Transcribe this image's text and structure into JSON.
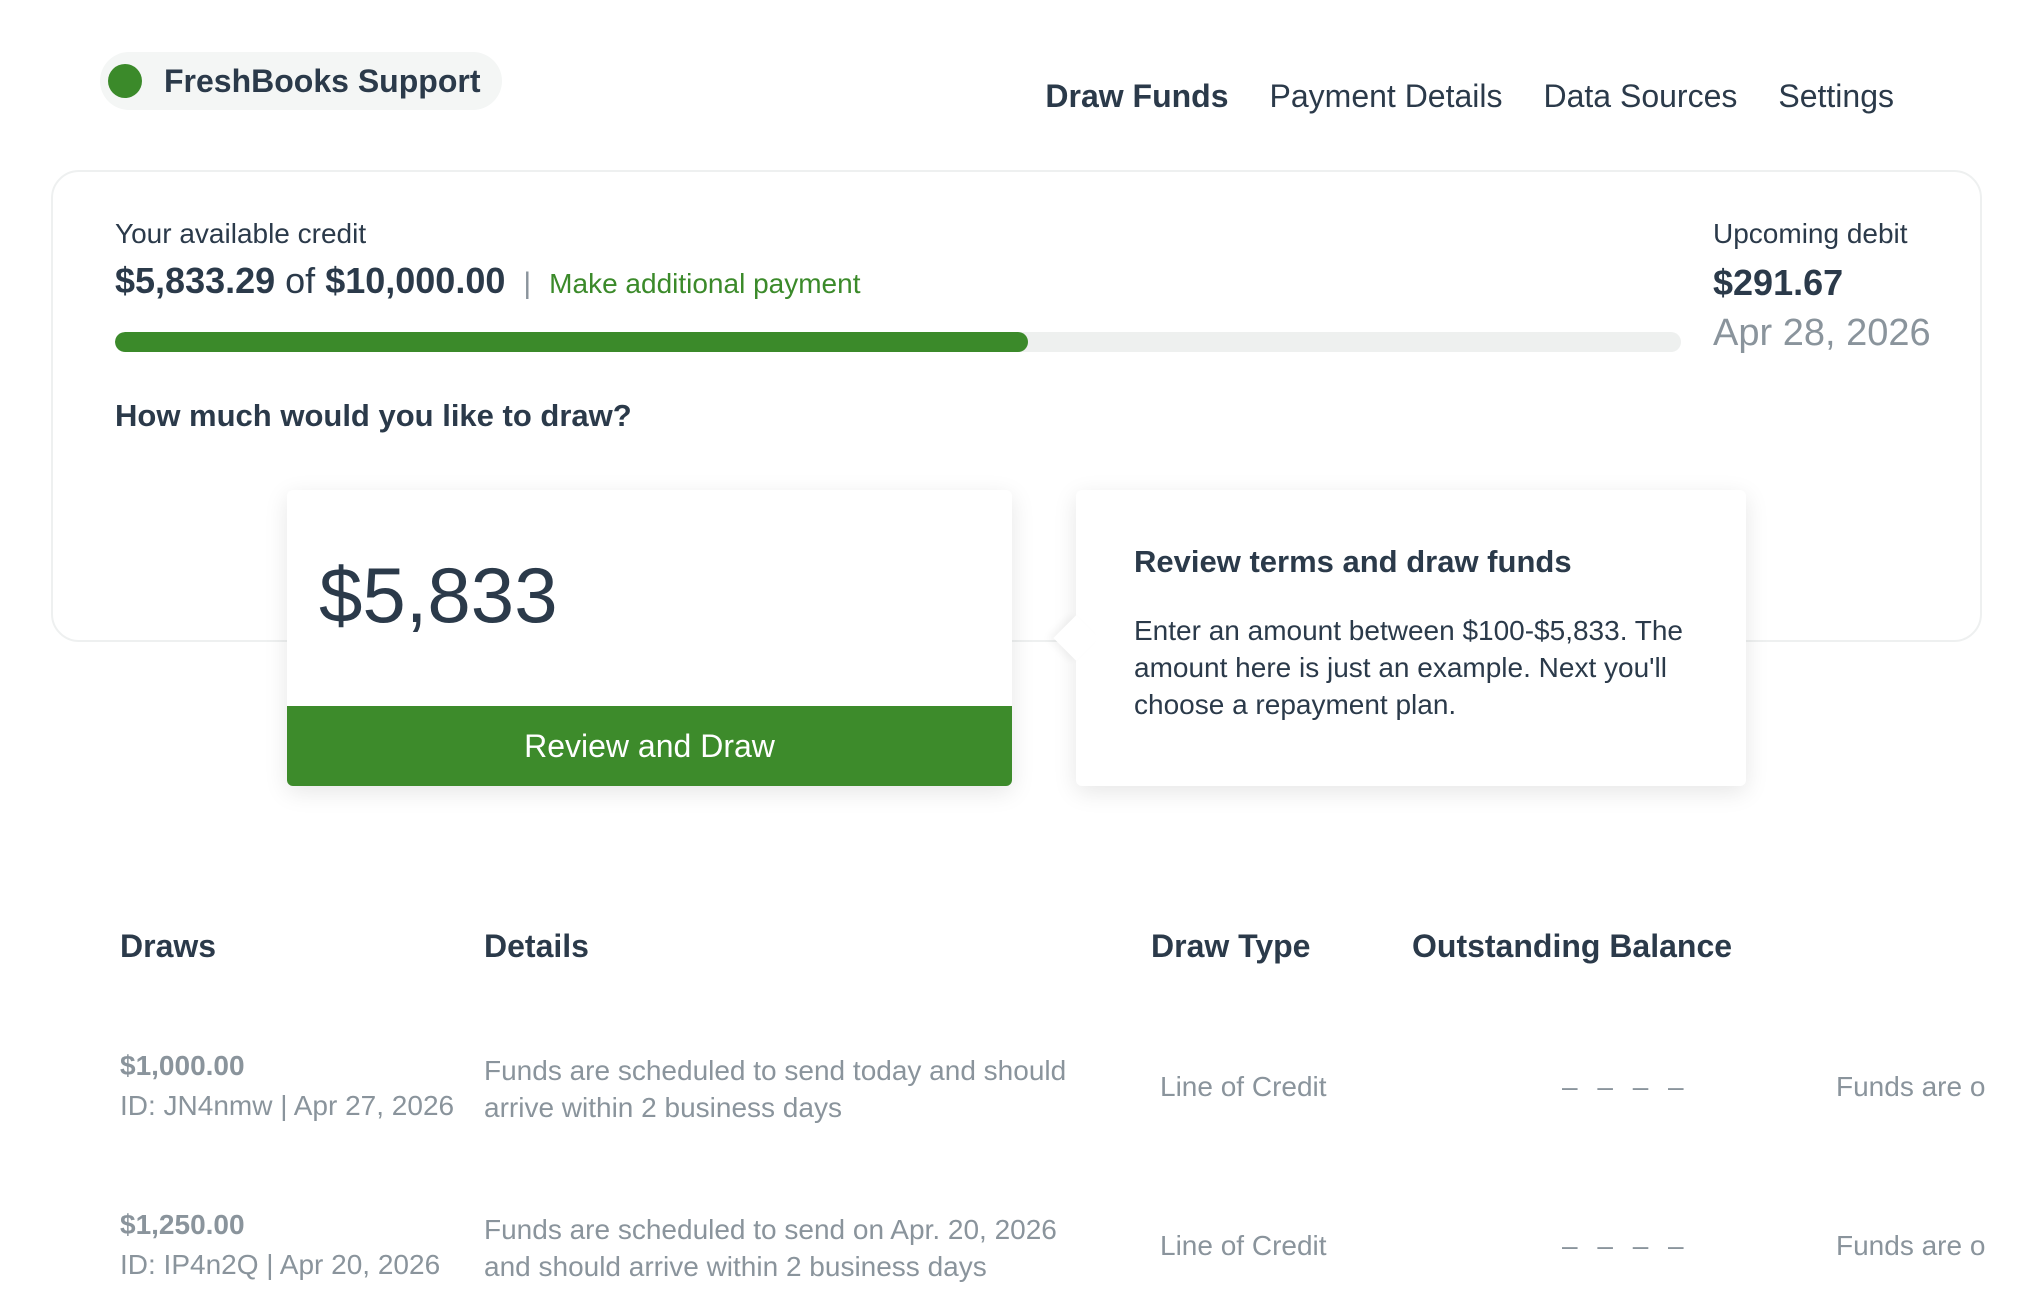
{
  "brand": {
    "name": "FreshBooks Support"
  },
  "nav": {
    "items": [
      {
        "label": "Draw Funds"
      },
      {
        "label": "Payment Details"
      },
      {
        "label": "Data Sources"
      },
      {
        "label": "Settings"
      }
    ]
  },
  "credit": {
    "label": "Your available credit",
    "available": "$5,833.29",
    "of": "of",
    "limit": "$10,000.00",
    "separator": "|",
    "payment_link": "Make additional payment",
    "progress_percent": 58.3
  },
  "debit": {
    "label": "Upcoming debit",
    "amount": "$291.67",
    "date": "Apr 28, 2026"
  },
  "draw": {
    "question": "How much would you like to draw?",
    "amount_value": "$5,833",
    "button_label": "Review and Draw"
  },
  "tooltip": {
    "title": "Review terms and draw funds",
    "body": "Enter an amount between $100-$5,833. The amount here is just an example. Next you'll choose a repayment plan."
  },
  "table": {
    "headers": [
      "Draws",
      "Details",
      "Draw Type",
      "Outstanding Balance"
    ],
    "rows": [
      {
        "amount": "$1,000.00",
        "id_date": "ID: JN4nmw | Apr 27, 2026",
        "details": "Funds are scheduled to send today and should arrive within 2 business days",
        "type": "Line of Credit",
        "balance": "– – – –",
        "status": "Funds are o"
      },
      {
        "amount": "$1,250.00",
        "id_date": "ID: IP4n2Q | Apr 20, 2026",
        "details": "Funds are scheduled to send on Apr. 20, 2026 and should arrive within 2 business days",
        "type": "Line of Credit",
        "balance": "– – – –",
        "status": "Funds are o"
      }
    ]
  },
  "colors": {
    "brand_green": "#3b8a2a",
    "text_dark": "#2b3a4a",
    "text_muted": "#8a949c"
  }
}
